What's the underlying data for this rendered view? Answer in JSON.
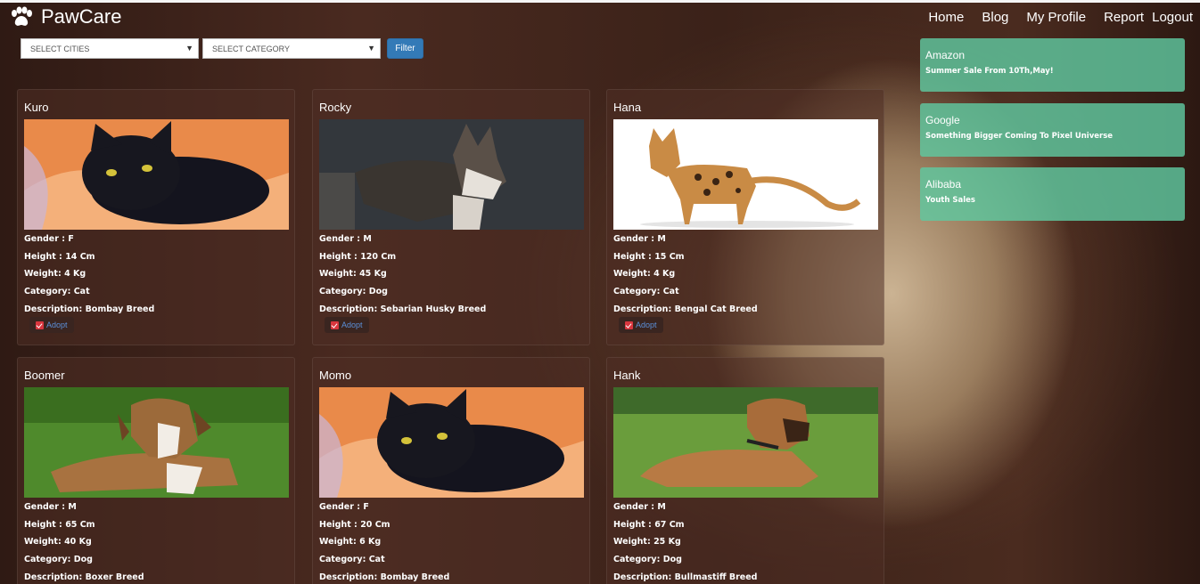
{
  "app": {
    "name": "PawCare"
  },
  "nav": {
    "home": "Home",
    "blog": "Blog",
    "profile": "My Profile",
    "report": "Report",
    "logout": "Logout"
  },
  "filters": {
    "cities": "SELECT CITIES",
    "category": "SELECT CATEGORY",
    "button": "Filter"
  },
  "labels": {
    "gender": "Gender :",
    "height": "Height :",
    "weight": "Weight:",
    "category": "Category:",
    "description": "Description:",
    "adopt": "Adopt"
  },
  "pets": [
    {
      "name": "Kuro",
      "gender": "F",
      "height": "14 Cm",
      "weight": "4 Kg",
      "category": "Cat",
      "description": "Bombay Breed"
    },
    {
      "name": "Rocky",
      "gender": "M",
      "height": "120 Cm",
      "weight": "45 Kg",
      "category": "Dog",
      "description": "Sebarian Husky Breed"
    },
    {
      "name": "Hana",
      "gender": "M",
      "height": "15 Cm",
      "weight": "4 Kg",
      "category": "Cat",
      "description": "Bengal Cat Breed"
    },
    {
      "name": "Boomer",
      "gender": "M",
      "height": "65 Cm",
      "weight": "40 Kg",
      "category": "Dog",
      "description": "Boxer Breed"
    },
    {
      "name": "Momo",
      "gender": "F",
      "height": "20 Cm",
      "weight": "6 Kg",
      "category": "Cat",
      "description": "Bombay Breed"
    },
    {
      "name": "Hank",
      "gender": "M",
      "height": "67 Cm",
      "weight": "25 Kg",
      "category": "Dog",
      "description": "Bullmastiff Breed"
    }
  ],
  "promos": [
    {
      "title": "Amazon",
      "text": "Summer Sale From 10Th,May!"
    },
    {
      "title": "Google",
      "text": "Something Bigger Coming To Pixel Universe"
    },
    {
      "title": "Alibaba",
      "text": "Youth Sales"
    }
  ],
  "colors": {
    "promo": "#5fc8a0",
    "filter_button": "#337ab7",
    "adopt_icon": "#d9363e"
  }
}
